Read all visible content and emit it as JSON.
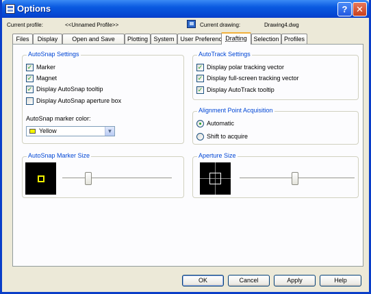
{
  "window": {
    "title": "Options",
    "help_glyph": "?",
    "close_glyph": "✕"
  },
  "profile": {
    "current_profile_label": "Current profile:",
    "current_profile_value": "<<Unnamed Profile>>",
    "current_drawing_label": "Current drawing:",
    "current_drawing_value": "Drawing4.dwg"
  },
  "tabs": [
    {
      "label": "Files"
    },
    {
      "label": "Display"
    },
    {
      "label": "Open and Save"
    },
    {
      "label": "Plotting"
    },
    {
      "label": "System"
    },
    {
      "label": "User Preferences"
    },
    {
      "label": "Drafting",
      "active": true
    },
    {
      "label": "Selection"
    },
    {
      "label": "Profiles"
    }
  ],
  "autosnap": {
    "title": "AutoSnap Settings",
    "items": [
      {
        "label": "Marker",
        "checked": true
      },
      {
        "label": "Magnet",
        "checked": true
      },
      {
        "label": "Display AutoSnap tooltip",
        "checked": true
      },
      {
        "label": "Display AutoSnap aperture box",
        "checked": false
      }
    ],
    "color_label": "AutoSnap marker color:",
    "color_value": "Yellow",
    "color_hex": "#f4f400"
  },
  "autotrack": {
    "title": "AutoTrack Settings",
    "items": [
      {
        "label": "Display polar tracking vector",
        "checked": true
      },
      {
        "label": "Display full-screen tracking vector",
        "checked": true
      },
      {
        "label": "Display AutoTrack tooltip",
        "checked": true
      }
    ]
  },
  "alignment": {
    "title": "Alignment Point Acquisition",
    "options": [
      {
        "label": "Automatic",
        "selected": true
      },
      {
        "label": "Shift to acquire",
        "selected": false
      }
    ]
  },
  "marker_size": {
    "title": "AutoSnap Marker Size",
    "slider_fraction": 0.24
  },
  "aperture_size": {
    "title": "Aperture Size",
    "slider_fraction": 0.48
  },
  "buttons": {
    "ok": "OK",
    "cancel": "Cancel",
    "apply": "Apply",
    "help": "Help"
  },
  "colors": {
    "titlebar": "#0a5ae0",
    "group_title": "#0046d5",
    "check": "#21a121"
  }
}
